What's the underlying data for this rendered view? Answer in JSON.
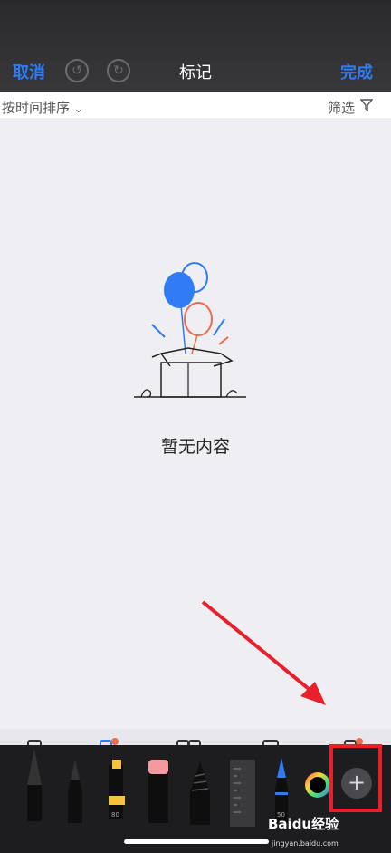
{
  "nav": {
    "cancel": "取消",
    "title": "标记",
    "done": "完成"
  },
  "sort": {
    "label": "按时间排序",
    "filter": "筛选"
  },
  "empty": {
    "text": "暂无内容"
  },
  "toolbar": {
    "highlighter_number": "80",
    "marker_number": "50",
    "plus": "+"
  },
  "watermark": {
    "text": "Baidu经验",
    "sub": "jingyan.baidu.com"
  },
  "colors": {
    "accent": "#2f7cf6",
    "highlight_box": "#e8202c",
    "arrow": "#e8202c"
  }
}
